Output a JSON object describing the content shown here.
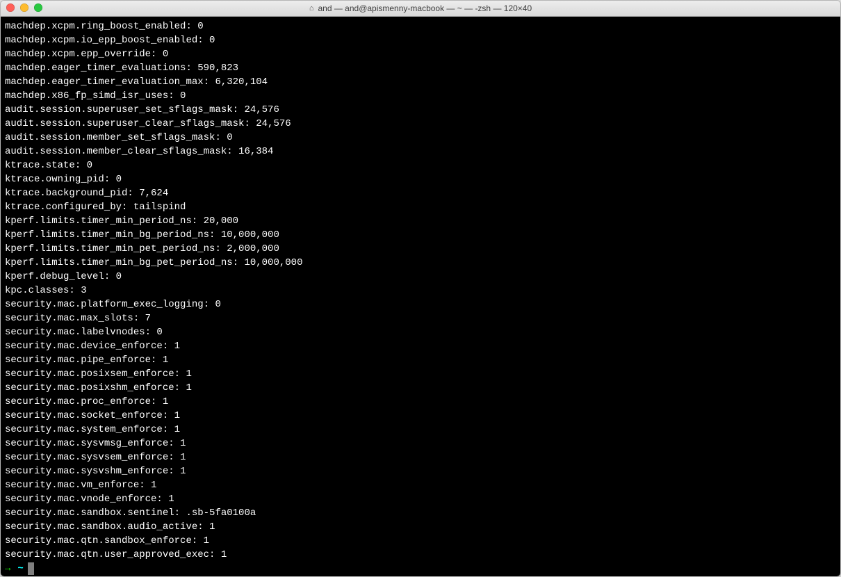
{
  "window": {
    "title": "and — and@apismenny-macbook — ~ — -zsh — 120×40"
  },
  "prompt": {
    "arrow": "→",
    "tilde": "~"
  },
  "lines": [
    {
      "key": "machdep.xcpm.ring_boost_enabled",
      "value": "0"
    },
    {
      "key": "machdep.xcpm.io_epp_boost_enabled",
      "value": "0"
    },
    {
      "key": "machdep.xcpm.epp_override",
      "value": "0"
    },
    {
      "key": "machdep.eager_timer_evaluations",
      "value": "590,823"
    },
    {
      "key": "machdep.eager_timer_evaluation_max",
      "value": "6,320,104"
    },
    {
      "key": "machdep.x86_fp_simd_isr_uses",
      "value": "0"
    },
    {
      "key": "audit.session.superuser_set_sflags_mask",
      "value": "24,576"
    },
    {
      "key": "audit.session.superuser_clear_sflags_mask",
      "value": "24,576"
    },
    {
      "key": "audit.session.member_set_sflags_mask",
      "value": "0"
    },
    {
      "key": "audit.session.member_clear_sflags_mask",
      "value": "16,384"
    },
    {
      "key": "ktrace.state",
      "value": "0"
    },
    {
      "key": "ktrace.owning_pid",
      "value": "0"
    },
    {
      "key": "ktrace.background_pid",
      "value": "7,624"
    },
    {
      "key": "ktrace.configured_by",
      "value": "tailspind"
    },
    {
      "key": "kperf.limits.timer_min_period_ns",
      "value": "20,000"
    },
    {
      "key": "kperf.limits.timer_min_bg_period_ns",
      "value": "10,000,000"
    },
    {
      "key": "kperf.limits.timer_min_pet_period_ns",
      "value": "2,000,000"
    },
    {
      "key": "kperf.limits.timer_min_bg_pet_period_ns",
      "value": "10,000,000"
    },
    {
      "key": "kperf.debug_level",
      "value": "0"
    },
    {
      "key": "kpc.classes",
      "value": "3"
    },
    {
      "key": "security.mac.platform_exec_logging",
      "value": "0"
    },
    {
      "key": "security.mac.max_slots",
      "value": "7"
    },
    {
      "key": "security.mac.labelvnodes",
      "value": "0"
    },
    {
      "key": "security.mac.device_enforce",
      "value": "1"
    },
    {
      "key": "security.mac.pipe_enforce",
      "value": "1"
    },
    {
      "key": "security.mac.posixsem_enforce",
      "value": "1"
    },
    {
      "key": "security.mac.posixshm_enforce",
      "value": "1"
    },
    {
      "key": "security.mac.proc_enforce",
      "value": "1"
    },
    {
      "key": "security.mac.socket_enforce",
      "value": "1"
    },
    {
      "key": "security.mac.system_enforce",
      "value": "1"
    },
    {
      "key": "security.mac.sysvmsg_enforce",
      "value": "1"
    },
    {
      "key": "security.mac.sysvsem_enforce",
      "value": "1"
    },
    {
      "key": "security.mac.sysvshm_enforce",
      "value": "1"
    },
    {
      "key": "security.mac.vm_enforce",
      "value": "1"
    },
    {
      "key": "security.mac.vnode_enforce",
      "value": "1"
    },
    {
      "key": "security.mac.sandbox.sentinel",
      "value": ".sb-5fa0100a"
    },
    {
      "key": "security.mac.sandbox.audio_active",
      "value": "1"
    },
    {
      "key": "security.mac.qtn.sandbox_enforce",
      "value": "1"
    },
    {
      "key": "security.mac.qtn.user_approved_exec",
      "value": "1"
    }
  ]
}
